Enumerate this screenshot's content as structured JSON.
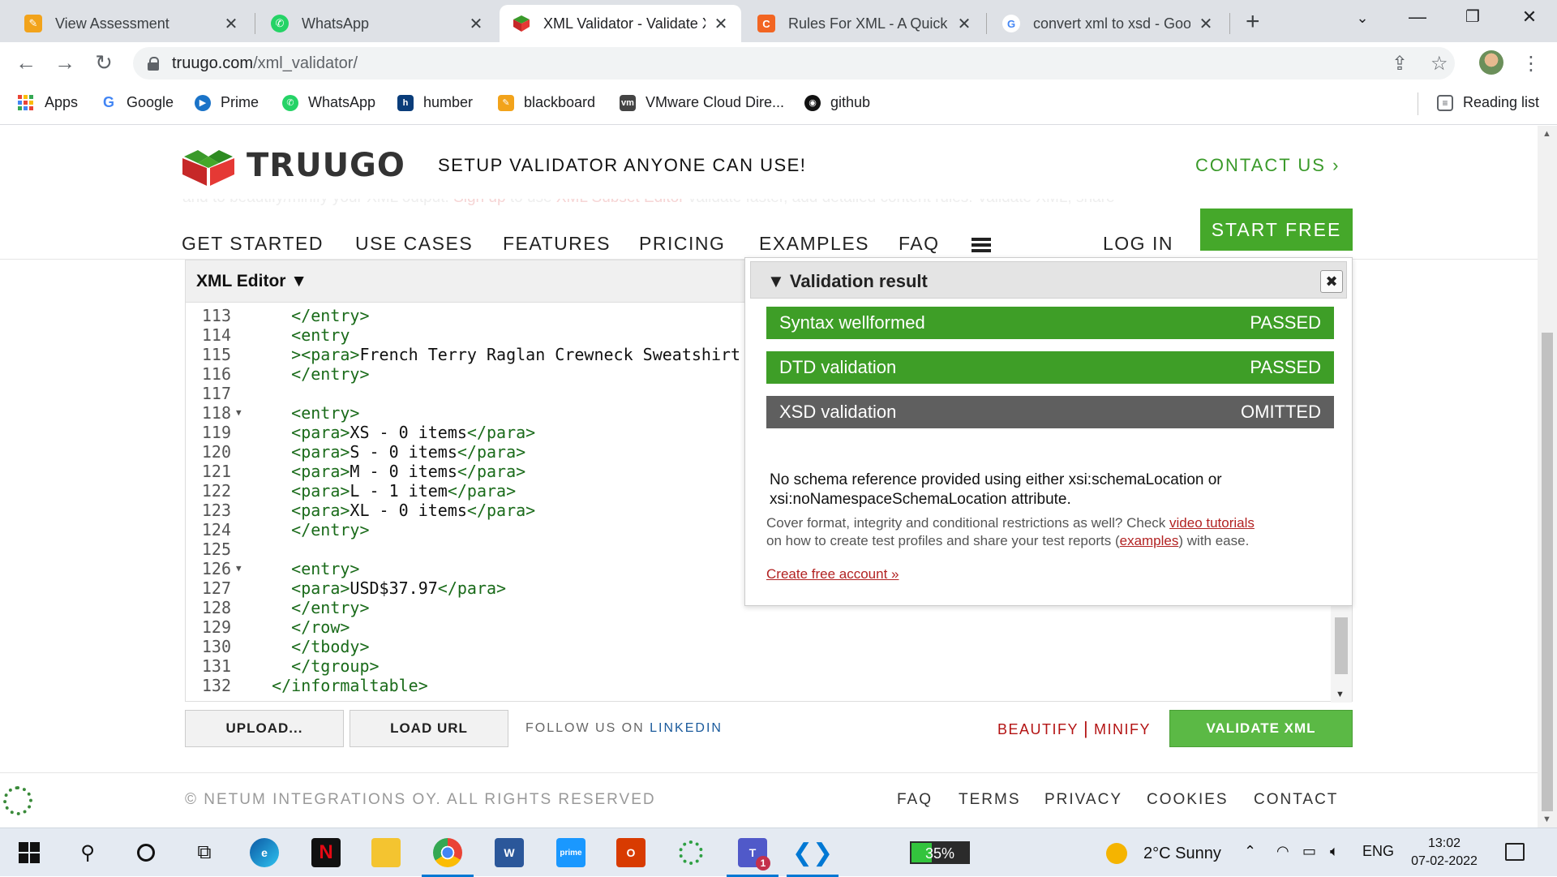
{
  "browser": {
    "tabs": [
      {
        "title": "View Assessment",
        "favicon": "pencil-icon"
      },
      {
        "title": "WhatsApp",
        "favicon": "whatsapp-icon"
      },
      {
        "title": "XML Validator - Validate XML",
        "favicon": "truugo-icon"
      },
      {
        "title": "Rules For XML - A Quick Reference",
        "favicon": "c-icon"
      },
      {
        "title": "convert xml to xsd - Google Search",
        "favicon": "google-icon"
      }
    ],
    "active_tab": 2,
    "url_host": "truugo.com",
    "url_path": "/xml_validator/",
    "bookmarks": [
      {
        "label": "Apps",
        "icon": "apps-grid-icon"
      },
      {
        "label": "Google",
        "icon": "google-icon"
      },
      {
        "label": "Prime",
        "icon": "prime-icon"
      },
      {
        "label": "WhatsApp",
        "icon": "whatsapp-icon"
      },
      {
        "label": "humber",
        "icon": "humber-icon"
      },
      {
        "label": "blackboard",
        "icon": "pencil-icon"
      },
      {
        "label": "VMware Cloud Dire...",
        "icon": "vmware-icon"
      },
      {
        "label": "github",
        "icon": "github-icon"
      }
    ],
    "reading_list": "Reading list"
  },
  "site": {
    "logo_text": "TRUUGO",
    "tagline": "SETUP VALIDATOR ANYONE CAN USE!",
    "contact_us": "CONTACT US ›",
    "nav": [
      "GET STARTED",
      "USE CASES",
      "FEATURES",
      "PRICING",
      "EXAMPLES",
      "FAQ"
    ],
    "login": "LOG IN",
    "start_free": "START FREE",
    "ghost_text_parts": [
      "and to beautify/minify your XML output.",
      "Sign up",
      "to use",
      "XML Subset Editor",
      "validate faster, add detailed content rules. Validate XML, share"
    ]
  },
  "editor": {
    "title": "XML Editor ▼",
    "lines": [
      {
        "n": "113",
        "fold": false,
        "indent": "    ",
        "parts": [
          [
            "tag",
            "</entry>"
          ]
        ]
      },
      {
        "n": "114",
        "fold": false,
        "indent": "    ",
        "parts": [
          [
            "tag",
            "<entry"
          ]
        ]
      },
      {
        "n": "115",
        "fold": false,
        "indent": "    ",
        "parts": [
          [
            "tag",
            "><para>"
          ],
          [
            "txt",
            "French Terry Raglan Crewneck Sweatshirt"
          ]
        ]
      },
      {
        "n": "116",
        "fold": false,
        "indent": "    ",
        "parts": [
          [
            "tag",
            "</entry>"
          ]
        ]
      },
      {
        "n": "117",
        "fold": false,
        "indent": "",
        "parts": []
      },
      {
        "n": "118",
        "fold": true,
        "indent": "    ",
        "parts": [
          [
            "tag",
            "<entry>"
          ]
        ]
      },
      {
        "n": "119",
        "fold": false,
        "indent": "    ",
        "parts": [
          [
            "tag",
            "<para>"
          ],
          [
            "txt",
            "XS - 0 items"
          ],
          [
            "tag",
            "</para>"
          ]
        ]
      },
      {
        "n": "120",
        "fold": false,
        "indent": "    ",
        "parts": [
          [
            "tag",
            "<para>"
          ],
          [
            "txt",
            "S - 0 items"
          ],
          [
            "tag",
            "</para>"
          ]
        ]
      },
      {
        "n": "121",
        "fold": false,
        "indent": "    ",
        "parts": [
          [
            "tag",
            "<para>"
          ],
          [
            "txt",
            "M - 0 items"
          ],
          [
            "tag",
            "</para>"
          ]
        ]
      },
      {
        "n": "122",
        "fold": false,
        "indent": "    ",
        "parts": [
          [
            "tag",
            "<para>"
          ],
          [
            "txt",
            "L - 1 item"
          ],
          [
            "tag",
            "</para>"
          ]
        ]
      },
      {
        "n": "123",
        "fold": false,
        "indent": "    ",
        "parts": [
          [
            "tag",
            "<para>"
          ],
          [
            "txt",
            "XL - 0 items"
          ],
          [
            "tag",
            "</para>"
          ]
        ]
      },
      {
        "n": "124",
        "fold": false,
        "indent": "    ",
        "parts": [
          [
            "tag",
            "</entry>"
          ]
        ]
      },
      {
        "n": "125",
        "fold": false,
        "indent": "",
        "parts": []
      },
      {
        "n": "126",
        "fold": true,
        "indent": "    ",
        "parts": [
          [
            "tag",
            "<entry>"
          ]
        ]
      },
      {
        "n": "127",
        "fold": false,
        "indent": "    ",
        "parts": [
          [
            "tag",
            "<para>"
          ],
          [
            "txt",
            "USD$37.97"
          ],
          [
            "tag",
            "</para>"
          ]
        ]
      },
      {
        "n": "128",
        "fold": false,
        "indent": "    ",
        "parts": [
          [
            "tag",
            "</entry>"
          ]
        ]
      },
      {
        "n": "129",
        "fold": false,
        "indent": "    ",
        "parts": [
          [
            "tag",
            "</row>"
          ]
        ]
      },
      {
        "n": "130",
        "fold": false,
        "indent": "    ",
        "parts": [
          [
            "tag",
            "</tbody>"
          ]
        ]
      },
      {
        "n": "131",
        "fold": false,
        "indent": "    ",
        "parts": [
          [
            "tag",
            "</tgroup>"
          ]
        ]
      },
      {
        "n": "132",
        "fold": false,
        "indent": "  ",
        "parts": [
          [
            "tag",
            "</informaltable>"
          ]
        ]
      }
    ],
    "upload": "UPLOAD...",
    "load_url": "LOAD URL",
    "follow_prefix": "FOLLOW US ON",
    "follow_link": "LINKEDIN",
    "beautify": "BEAUTIFY",
    "separator": "|",
    "minify": "MINIFY",
    "validate": "VALIDATE XML"
  },
  "result": {
    "title": "▼ Validation result",
    "close": "✖",
    "rows": [
      {
        "label": "Syntax wellformed",
        "status": "PASSED",
        "kind": "pass"
      },
      {
        "label": "DTD validation",
        "status": "PASSED",
        "kind": "pass"
      },
      {
        "label": "XSD validation",
        "status": "OMITTED",
        "kind": "omit"
      }
    ],
    "schema_note": "No schema reference provided using either xsi:schemaLocation or xsi:noNamespaceSchemaLocation attribute.",
    "cover_pre": "Cover format, integrity and conditional restrictions as well? Check",
    "cover_link1": "video tutorials",
    "cover_mid": "on how to create test profiles and share your test reports (",
    "cover_link2": "examples",
    "cover_post": ") with ease.",
    "create_account": "Create free account »"
  },
  "footer": {
    "copyright": "© NETUM INTEGRATIONS OY. ALL RIGHTS RESERVED",
    "links": [
      "FAQ",
      "TERMS",
      "PRIVACY",
      "COOKIES",
      "CONTACT"
    ]
  },
  "taskbar": {
    "battery_percent": 35,
    "battery_label": "35%",
    "weather": "2°C  Sunny",
    "lang": "ENG",
    "time": "13:02",
    "date": "07-02-2022",
    "teams_badge": "1"
  },
  "colors": {
    "brand_green": "#45a82a",
    "pass_green": "#3e9e27",
    "omit_gray": "#5f5f5f",
    "link_red": "#b22222",
    "xml_tag": "#1a6b1a"
  }
}
